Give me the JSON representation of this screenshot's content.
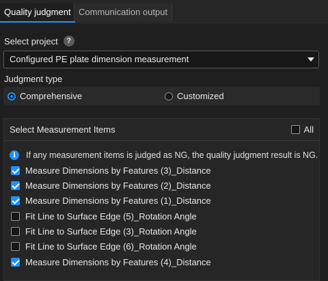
{
  "tabs": [
    {
      "label": "Quality judgment",
      "active": true
    },
    {
      "label": "Communication output",
      "active": false
    }
  ],
  "select_project": {
    "label": "Select project",
    "help_icon": "help-icon",
    "value": "Configured PE plate dimension measurement"
  },
  "judgment_type": {
    "label": "Judgment type",
    "options": [
      {
        "label": "Comprehensive",
        "selected": true
      },
      {
        "label": "Customized",
        "selected": false
      }
    ]
  },
  "measurement": {
    "title": "Select Measurement Items",
    "all_label": "All",
    "all_checked": false,
    "info_text": "If any measurement items is judged as NG, the quality judgment result is NG.",
    "items": [
      {
        "label": "Measure Dimensions by Features (3)_Distance",
        "checked": true
      },
      {
        "label": "Measure Dimensions by Features (2)_Distance",
        "checked": true
      },
      {
        "label": "Measure Dimensions by Features (1)_Distance",
        "checked": true
      },
      {
        "label": "Fit Line to Surface Edge (5)_Rotation Angle",
        "checked": false
      },
      {
        "label": "Fit Line to Surface Edge (3)_Rotation Angle",
        "checked": false
      },
      {
        "label": "Fit Line to Surface Edge (6)_Rotation Angle",
        "checked": false
      },
      {
        "label": "Measure Dimensions by Features (4)_Distance",
        "checked": true
      }
    ]
  },
  "colors": {
    "accent": "#1e90ff",
    "background": "#1f1f1f",
    "panel": "#262626"
  }
}
